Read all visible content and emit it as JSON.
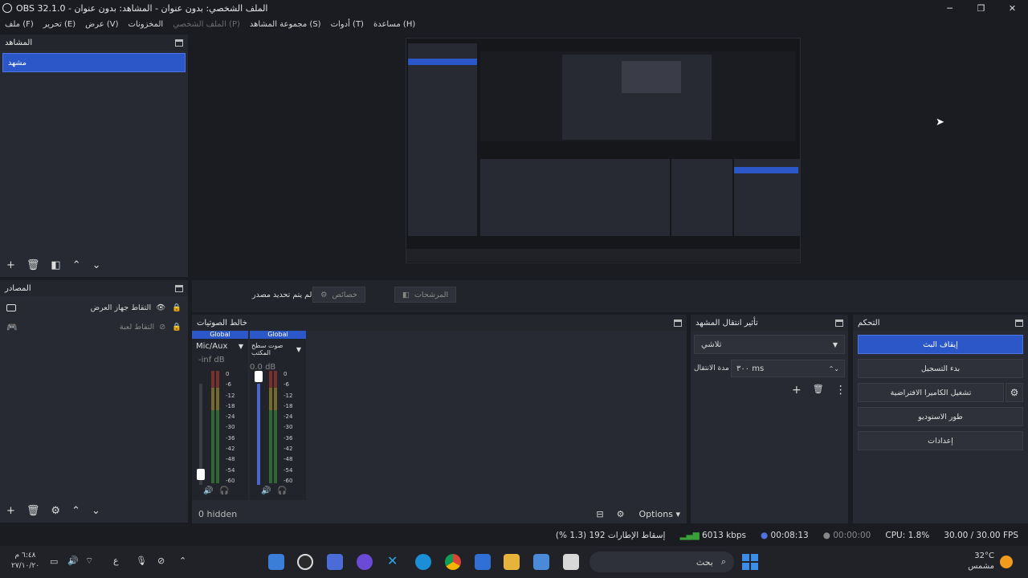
{
  "window": {
    "title": "OBS 32.1.0 - الملف الشخصي: بدون عنوان - المشاهد: بدون عنوان"
  },
  "menu": [
    {
      "label": "ملف (F)",
      "disabled": false
    },
    {
      "label": "تحرير (E)",
      "disabled": false
    },
    {
      "label": "عرض (V)",
      "disabled": false
    },
    {
      "label": "المخزونات",
      "disabled": false
    },
    {
      "label": "الملف الشخصي (P)",
      "disabled": true
    },
    {
      "label": "مجموعة المشاهد (S)",
      "disabled": false
    },
    {
      "label": "أدوات (T)",
      "disabled": false
    },
    {
      "label": "مساعدة (H)",
      "disabled": false
    }
  ],
  "scenes": {
    "title": "المشاهد",
    "items": [
      "مشهد"
    ]
  },
  "sources": {
    "title": "المصادر",
    "items": [
      {
        "label": "التقاط جهاز العرض",
        "icon": "monitor-icon",
        "visible": true
      },
      {
        "label": "التقاط لعبة",
        "icon": "gamepad-icon",
        "visible": false
      }
    ]
  },
  "context_bar": {
    "no_source": "لم يتم تحديد مصدر",
    "properties": "خصائص",
    "filters": "المرشحات"
  },
  "mixer": {
    "title": "خالط الصوتيات",
    "channels": [
      {
        "badge": "Global",
        "name": "Mic/Aux",
        "db": "-inf dB"
      },
      {
        "badge": "Global",
        "name": "صوت سطح المكتب",
        "db": "0.0 dB"
      }
    ],
    "scale": [
      "0",
      "-6",
      "-12",
      "-18",
      "-24",
      "-30",
      "-36",
      "-42",
      "-48",
      "-54",
      "-60"
    ],
    "hidden": "0 hidden",
    "options": "Options"
  },
  "transitions": {
    "title": "تأثير انتقال المشهد",
    "selected": "تلاشي",
    "duration_label": "مدة الانتقال",
    "duration_value": "٣٠٠ ms"
  },
  "controls": {
    "title": "التحكم",
    "buttons": [
      "إيقاف البث",
      "بدء التسجيل",
      "تشغيل الكاميرا الافتراضية",
      "طور الاستوديو",
      "إعدادات"
    ]
  },
  "status": {
    "dropped": "إسقاط الإطارات 192 (1.3 %)",
    "kbps": "6013 kbps",
    "stream_time": "00:08:13",
    "rec_time": "00:00:00",
    "cpu": "CPU: 1.8%",
    "fps": "30.00 / 30.00 FPS"
  },
  "taskbar": {
    "clock_time": "٦:٤٨ م",
    "clock_date": "٢٧/١٠/٢٠",
    "search": "بحث",
    "weather_temp": "32°C",
    "weather_desc": "مشمس",
    "lang": "ع"
  },
  "colors": {
    "accent": "#2c57c8",
    "panel": "#272a33",
    "background": "#1b1c22"
  }
}
